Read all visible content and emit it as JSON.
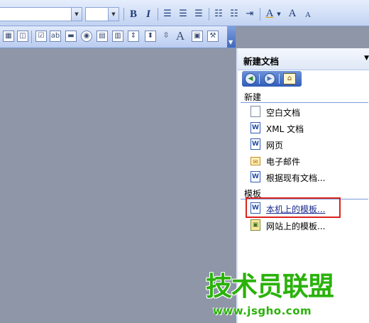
{
  "toolbar": {
    "bold_label": "B",
    "italic_label": "I",
    "font_color_label": "A",
    "grow_font_label": "A",
    "shrink_font_label": "A"
  },
  "drawing_toolbar": {
    "text_tool_label": "A"
  },
  "task_pane": {
    "title": "新建文档",
    "sections": {
      "new": {
        "label": "新建",
        "items": [
          {
            "label": "空白文档",
            "icon": "blank-document-icon"
          },
          {
            "label": "XML 文档",
            "icon": "word-document-icon"
          },
          {
            "label": "网页",
            "icon": "web-page-icon"
          },
          {
            "label": "电子邮件",
            "icon": "email-icon"
          },
          {
            "label": "根据现有文档...",
            "icon": "word-document-icon"
          }
        ]
      },
      "templates": {
        "label": "模板",
        "items": [
          {
            "label": "本机上的模板...",
            "icon": "word-document-icon"
          },
          {
            "label": "网站上的模板...",
            "icon": "web-templates-icon"
          }
        ]
      }
    }
  },
  "watermark": {
    "logo": "技术员联盟",
    "url": "www.jsgho.com"
  },
  "colors": {
    "highlight": "#d9231c",
    "link": "#1a2a8c",
    "watermark": "#2ab20a",
    "toolbar_blue": "#c2d3f2"
  }
}
